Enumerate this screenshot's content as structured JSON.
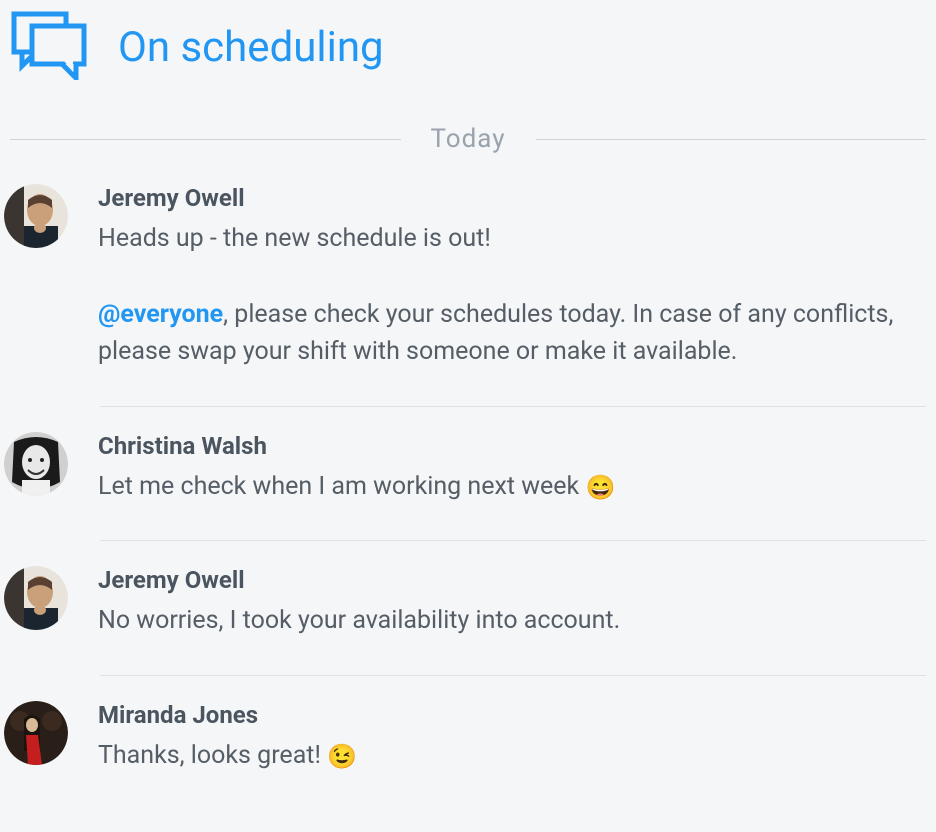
{
  "header": {
    "title": "On scheduling"
  },
  "date_divider": "Today",
  "messages": [
    {
      "author": "Jeremy Owell",
      "avatar_style": "jeremy",
      "paragraphs": [
        {
          "text": "Heads up - the new schedule is out!"
        },
        {
          "mention": "@everyone",
          "text": ", please check your schedules today. In case of any conflicts, please swap your shift with someone or make it available."
        }
      ]
    },
    {
      "author": "Christina Walsh",
      "avatar_style": "christina",
      "paragraphs": [
        {
          "text": "Let me check when I am working next week ",
          "emoji": "😄"
        }
      ]
    },
    {
      "author": "Jeremy Owell",
      "avatar_style": "jeremy",
      "paragraphs": [
        {
          "text": "No worries, I took your availability into account."
        }
      ]
    },
    {
      "author": "Miranda Jones",
      "avatar_style": "miranda",
      "paragraphs": [
        {
          "text": "Thanks, looks great! ",
          "emoji": "😉"
        }
      ]
    }
  ]
}
